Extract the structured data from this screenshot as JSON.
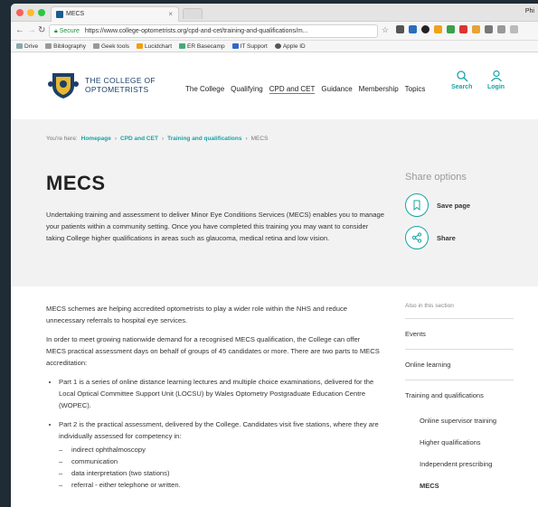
{
  "browser": {
    "tab_title": "MECS",
    "profile_label": "Phi",
    "secure_label": "Secure",
    "url": "https://www.college-optometrists.org/cpd-and-cet/training-and-qualifications/m...",
    "bookmarks": [
      "Drive",
      "Bibliography",
      "Geek tools",
      "Lucidchart",
      "ER Basecamp",
      "IT Support",
      "Apple ID"
    ]
  },
  "site": {
    "logo_line1": "THE COLLEGE OF",
    "logo_line2": "OPTOMETRISTS",
    "nav": [
      "The College",
      "Qualifying",
      "CPD and CET",
      "Guidance",
      "Membership",
      "Topics"
    ],
    "active_nav": "CPD and CET",
    "search_label": "Search",
    "login_label": "Login"
  },
  "breadcrumb": {
    "prefix": "You're here:",
    "items": [
      "Homepage",
      "CPD and CET",
      "Training and qualifications",
      "MECS"
    ],
    "sep": "›"
  },
  "page": {
    "title": "MECS",
    "intro": "Undertaking training and assessment to deliver Minor Eye Conditions Services (MECS) enables you to manage your patients within a community setting. Once you have completed this training you may want to consider taking College higher qualifications in areas such as glaucoma, medical retina and low vision.",
    "para1": "MECS schemes are helping accredited optometrists to play a wider role within the NHS and reduce unnecessary referrals to hospital eye services.",
    "para2": "In order to meet growing nationwide demand for a recognised MECS qualification, the College can offer MECS practical assessment days on behalf of groups of 45 candidates or more. There are two parts to MECS accreditation:",
    "bullet1": "Part 1 is a series of online distance learning lectures and multiple choice examinations, delivered for the Local Optical Committee Support Unit (LOCSU) by Wales Optometry Postgraduate Education Centre (WOPEC).",
    "bullet2": "Part 2 is the practical assessment, delivered by the College. Candidates visit five stations, where they are individually assessed for competency in:",
    "sub": [
      "indirect ophthalmoscopy",
      "communication",
      "data interpretation (two stations)",
      "referral - either telephone or written."
    ]
  },
  "share": {
    "heading": "Share options",
    "save_label": "Save page",
    "share_label": "Share"
  },
  "sidebar": {
    "heading": "Also in this section",
    "items": [
      "Events",
      "Online learning",
      "Training and qualifications"
    ],
    "subitems": [
      "Online supervisor training",
      "Higher qualifications",
      "Independent prescribing",
      "MECS"
    ]
  },
  "colors": {
    "accent": "#18a3a6",
    "brand": "#1b3f6a"
  }
}
